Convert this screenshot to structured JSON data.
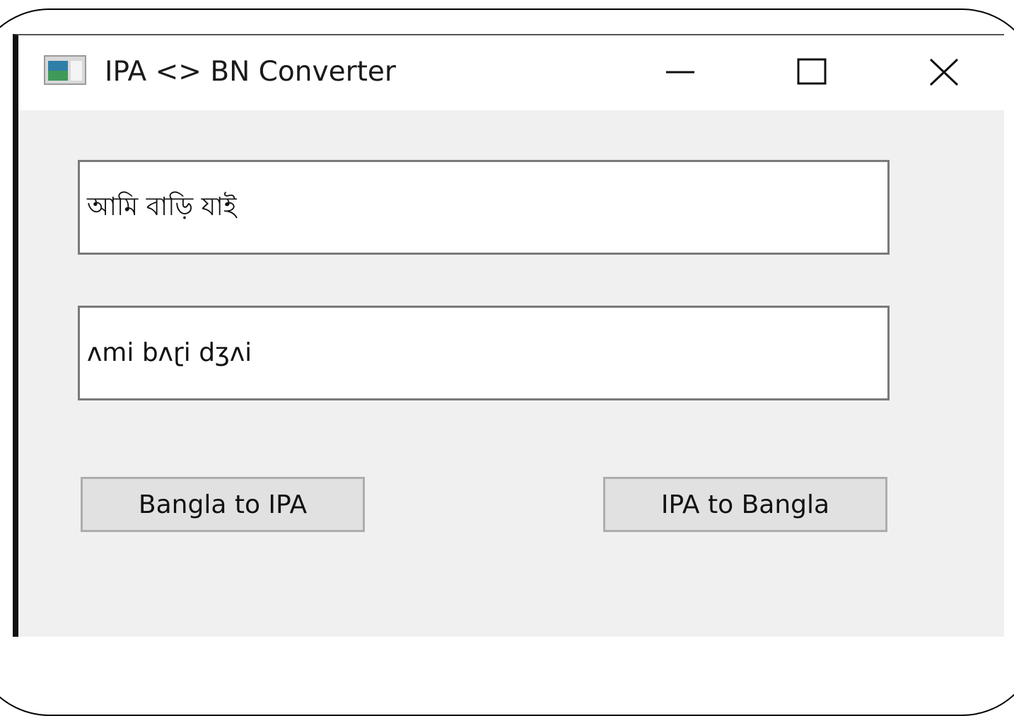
{
  "window": {
    "title": "IPA <> BN Converter"
  },
  "fields": {
    "bangla_value": "আমি বাড়ি যাই",
    "ipa_value": "ʌmi bʌɽi dʒʌi"
  },
  "buttons": {
    "bangla_to_ipa": "Bangla to IPA",
    "ipa_to_bangla": "IPA to Bangla"
  },
  "icons": {
    "app": "app-window-icon",
    "minimize": "minimize-icon",
    "maximize": "maximize-icon",
    "close": "close-icon"
  },
  "colors": {
    "client_background": "#f0f0f0",
    "button_background": "#e1e1e1",
    "field_border": "#7a7a7a"
  }
}
